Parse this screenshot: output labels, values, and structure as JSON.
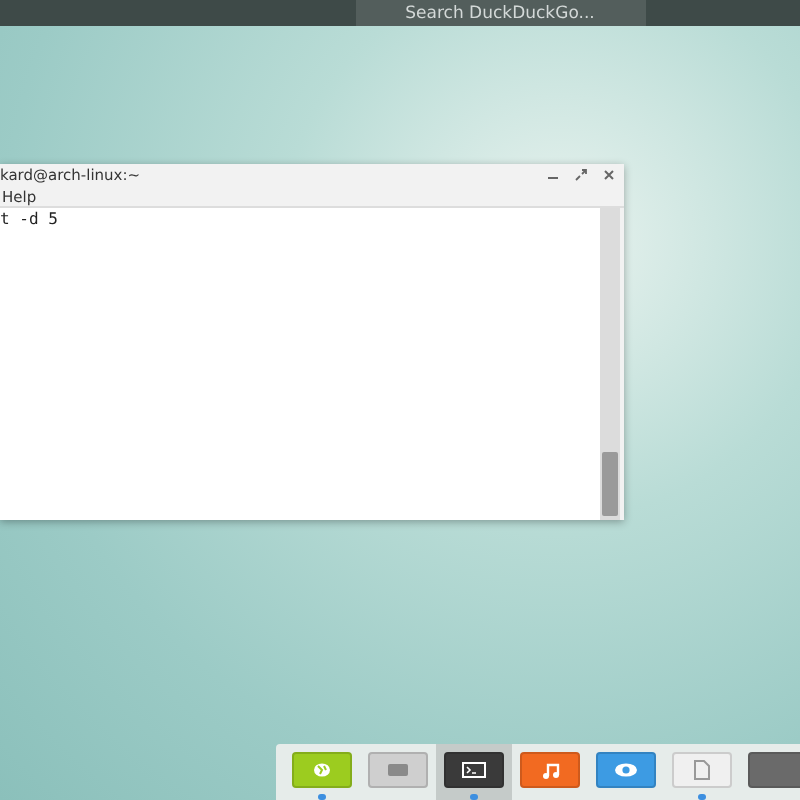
{
  "top_bar": {
    "search": {
      "placeholder": "Search DuckDuckGo..."
    }
  },
  "terminal": {
    "title": "kard@arch-linux:~",
    "menu": [
      "Help"
    ],
    "lines": [
      "t -d 5"
    ]
  },
  "dock": {
    "items": [
      {
        "kind": "globe",
        "color": "#9ccc1f",
        "running": true,
        "selected": false
      },
      {
        "kind": "folder",
        "color": "#cfcfcf",
        "running": false,
        "selected": false
      },
      {
        "kind": "terminal",
        "color": "#3a3a3a",
        "running": true,
        "selected": true
      },
      {
        "kind": "music",
        "color": "#f26a21",
        "running": false,
        "selected": false
      },
      {
        "kind": "eye",
        "color": "#3d9be3",
        "running": false,
        "selected": false
      },
      {
        "kind": "file",
        "color": "#f0f0f0",
        "running": true,
        "selected": false
      },
      {
        "kind": "app",
        "color": "#6a6a6a",
        "running": false,
        "selected": false
      }
    ]
  }
}
